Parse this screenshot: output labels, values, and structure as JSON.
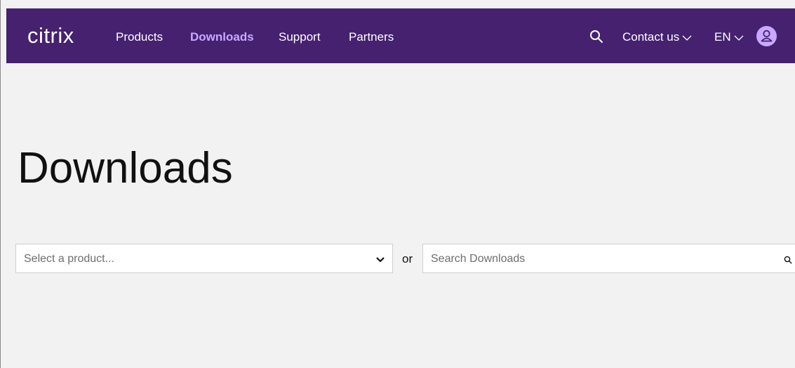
{
  "brand": {
    "logo_text": "citrix",
    "nav_bg": "#452170",
    "accent": "#c9a8ff"
  },
  "nav": {
    "items": [
      {
        "label": "Products",
        "active": false
      },
      {
        "label": "Downloads",
        "active": true
      },
      {
        "label": "Support",
        "active": false
      },
      {
        "label": "Partners",
        "active": false
      }
    ],
    "search_icon": "search-icon",
    "contact_label": "Contact us",
    "language_label": "EN",
    "account_icon": "user-icon"
  },
  "main": {
    "title": "Downloads",
    "product_select": {
      "placeholder": "Select a product...",
      "icon": "chevron-down-icon"
    },
    "or_text": "or",
    "search": {
      "placeholder": "Search Downloads",
      "value": "",
      "icon": "search-icon"
    }
  }
}
